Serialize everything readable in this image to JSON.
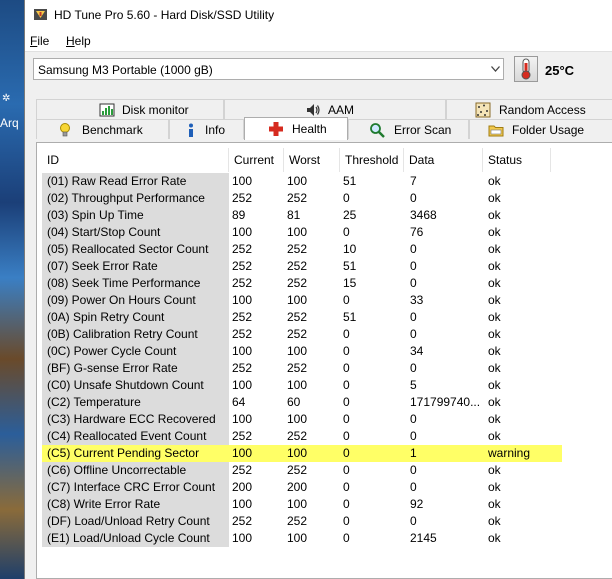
{
  "window": {
    "title": "HD Tune Pro 5.60 - Hard Disk/SSD Utility"
  },
  "menu": {
    "file": "File",
    "help": "Help"
  },
  "toolbar": {
    "drive": "Samsung M3 Portable (1000 gB)",
    "temperature": "25°C"
  },
  "desktop": {
    "partial_label": "Arq"
  },
  "tabs": {
    "row1": [
      {
        "label": "Disk monitor",
        "icon": "disk-monitor-icon"
      },
      {
        "label": "AAM",
        "icon": "speaker-icon"
      },
      {
        "label": "Random Access",
        "icon": "random-access-icon"
      }
    ],
    "row2": [
      {
        "label": "Benchmark",
        "icon": "bulb-icon"
      },
      {
        "label": "Info",
        "icon": "info-icon"
      },
      {
        "label": "Health",
        "icon": "health-cross-icon"
      },
      {
        "label": "Error Scan",
        "icon": "magnifier-icon"
      },
      {
        "label": "Folder Usage",
        "icon": "folder-icon"
      }
    ],
    "active": "Health"
  },
  "health_table": {
    "columns": [
      "ID",
      "Current",
      "Worst",
      "Threshold",
      "Data",
      "Status"
    ],
    "rows": [
      [
        "(01) Raw Read Error Rate",
        "100",
        "100",
        "51",
        "7",
        "ok"
      ],
      [
        "(02) Throughput Performance",
        "252",
        "252",
        "0",
        "0",
        "ok"
      ],
      [
        "(03) Spin Up Time",
        "89",
        "81",
        "25",
        "3468",
        "ok"
      ],
      [
        "(04) Start/Stop Count",
        "100",
        "100",
        "0",
        "76",
        "ok"
      ],
      [
        "(05) Reallocated Sector Count",
        "252",
        "252",
        "10",
        "0",
        "ok"
      ],
      [
        "(07) Seek Error Rate",
        "252",
        "252",
        "51",
        "0",
        "ok"
      ],
      [
        "(08) Seek Time Performance",
        "252",
        "252",
        "15",
        "0",
        "ok"
      ],
      [
        "(09) Power On Hours Count",
        "100",
        "100",
        "0",
        "33",
        "ok"
      ],
      [
        "(0A) Spin Retry Count",
        "252",
        "252",
        "51",
        "0",
        "ok"
      ],
      [
        "(0B) Calibration Retry Count",
        "252",
        "252",
        "0",
        "0",
        "ok"
      ],
      [
        "(0C) Power Cycle Count",
        "100",
        "100",
        "0",
        "34",
        "ok"
      ],
      [
        "(BF) G-sense Error Rate",
        "252",
        "252",
        "0",
        "0",
        "ok"
      ],
      [
        "(C0) Unsafe Shutdown Count",
        "100",
        "100",
        "0",
        "5",
        "ok"
      ],
      [
        "(C2) Temperature",
        "64",
        "60",
        "0",
        "171799740...",
        "ok"
      ],
      [
        "(C3) Hardware ECC Recovered",
        "100",
        "100",
        "0",
        "0",
        "ok"
      ],
      [
        "(C4) Reallocated Event Count",
        "252",
        "252",
        "0",
        "0",
        "ok"
      ],
      [
        "(C5) Current Pending Sector",
        "100",
        "100",
        "0",
        "1",
        "warning"
      ],
      [
        "(C6) Offline Uncorrectable",
        "252",
        "252",
        "0",
        "0",
        "ok"
      ],
      [
        "(C7) Interface CRC Error Count",
        "200",
        "200",
        "0",
        "0",
        "ok"
      ],
      [
        "(C8) Write Error Rate",
        "100",
        "100",
        "0",
        "92",
        "ok"
      ],
      [
        "(DF) Load/Unload Retry Count",
        "252",
        "252",
        "0",
        "0",
        "ok"
      ],
      [
        "(E1) Load/Unload Cycle Count",
        "100",
        "100",
        "0",
        "2145",
        "ok"
      ]
    ],
    "highlight_color": "#ffff66"
  }
}
